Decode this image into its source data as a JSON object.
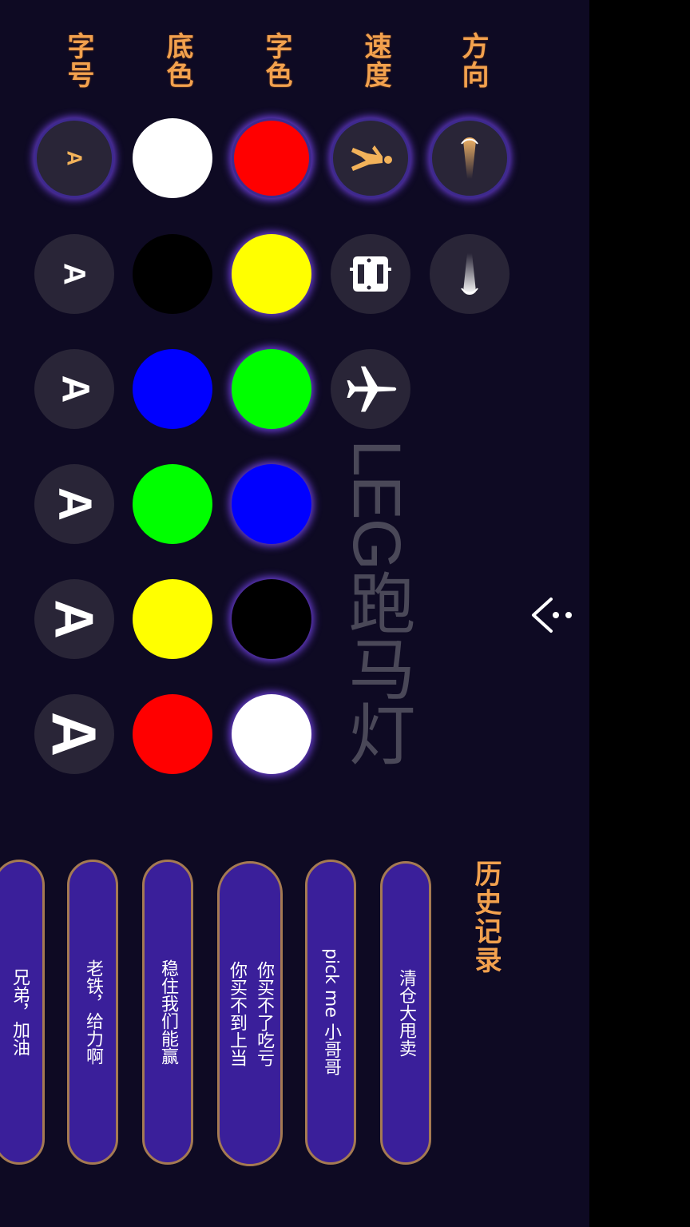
{
  "labels": {
    "direction": "方向",
    "speed": "速度",
    "text_color": "字色",
    "bg_color": "底色",
    "font_size": "字号"
  },
  "watermark": "LEG跑马灯",
  "size_glyph": "A",
  "text_colors": [
    "#ff0000",
    "#ffff00",
    "#00ff00",
    "#0000ff",
    "#000000",
    "#ffffff"
  ],
  "bg_colors": [
    "#ffffff",
    "#000000",
    "#0000ff",
    "#00ff00",
    "#ffff00",
    "#ff0000"
  ],
  "history": {
    "title": "历史记录",
    "items": [
      "清仓大甩卖",
      "pick me 小哥哥",
      "你买不了吃亏\n你买不到上当",
      "稳住我们能赢",
      "老铁，给力啊",
      "兄弟，加油"
    ]
  },
  "colors": {
    "background": "#0e0a23",
    "accent": "#f2a14e",
    "pill": "#3a1f9a",
    "button": "#292537"
  }
}
